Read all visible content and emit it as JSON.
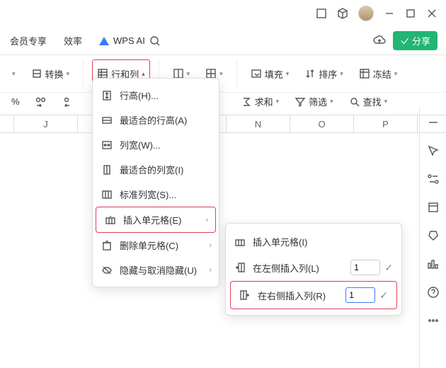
{
  "tabs": {
    "member": "会员专享",
    "efficiency": "效率",
    "wpsai": "WPS AI"
  },
  "share": "分享",
  "toolbar": {
    "convert": "转换",
    "rowscols": "行和列",
    "fill": "填充",
    "sort": "排序",
    "freeze": "冻结",
    "sum": "求和",
    "filter": "筛选",
    "find": "查找"
  },
  "fmt": {
    "percent": "%",
    "dec_inc": ".00",
    "dec_dec": ".0"
  },
  "cols": {
    "j": "J",
    "n": "N",
    "o": "O",
    "p": "P"
  },
  "menu": {
    "rowheight": "行高(H)...",
    "bestrow": "最适合的行高(A)",
    "colwidth": "列宽(W)...",
    "bestcol": "最适合的列宽(I)",
    "stdwidth": "标准列宽(S)...",
    "insert": "插入单元格(E)",
    "delete": "删除单元格(C)",
    "hide": "隐藏与取消隐藏(U)"
  },
  "submenu": {
    "insertcell": "插入单元格(I)",
    "insleft": "在左侧插入列(L)",
    "insright": "在右侧插入列(R)",
    "val_left": "1",
    "val_right": "1"
  }
}
